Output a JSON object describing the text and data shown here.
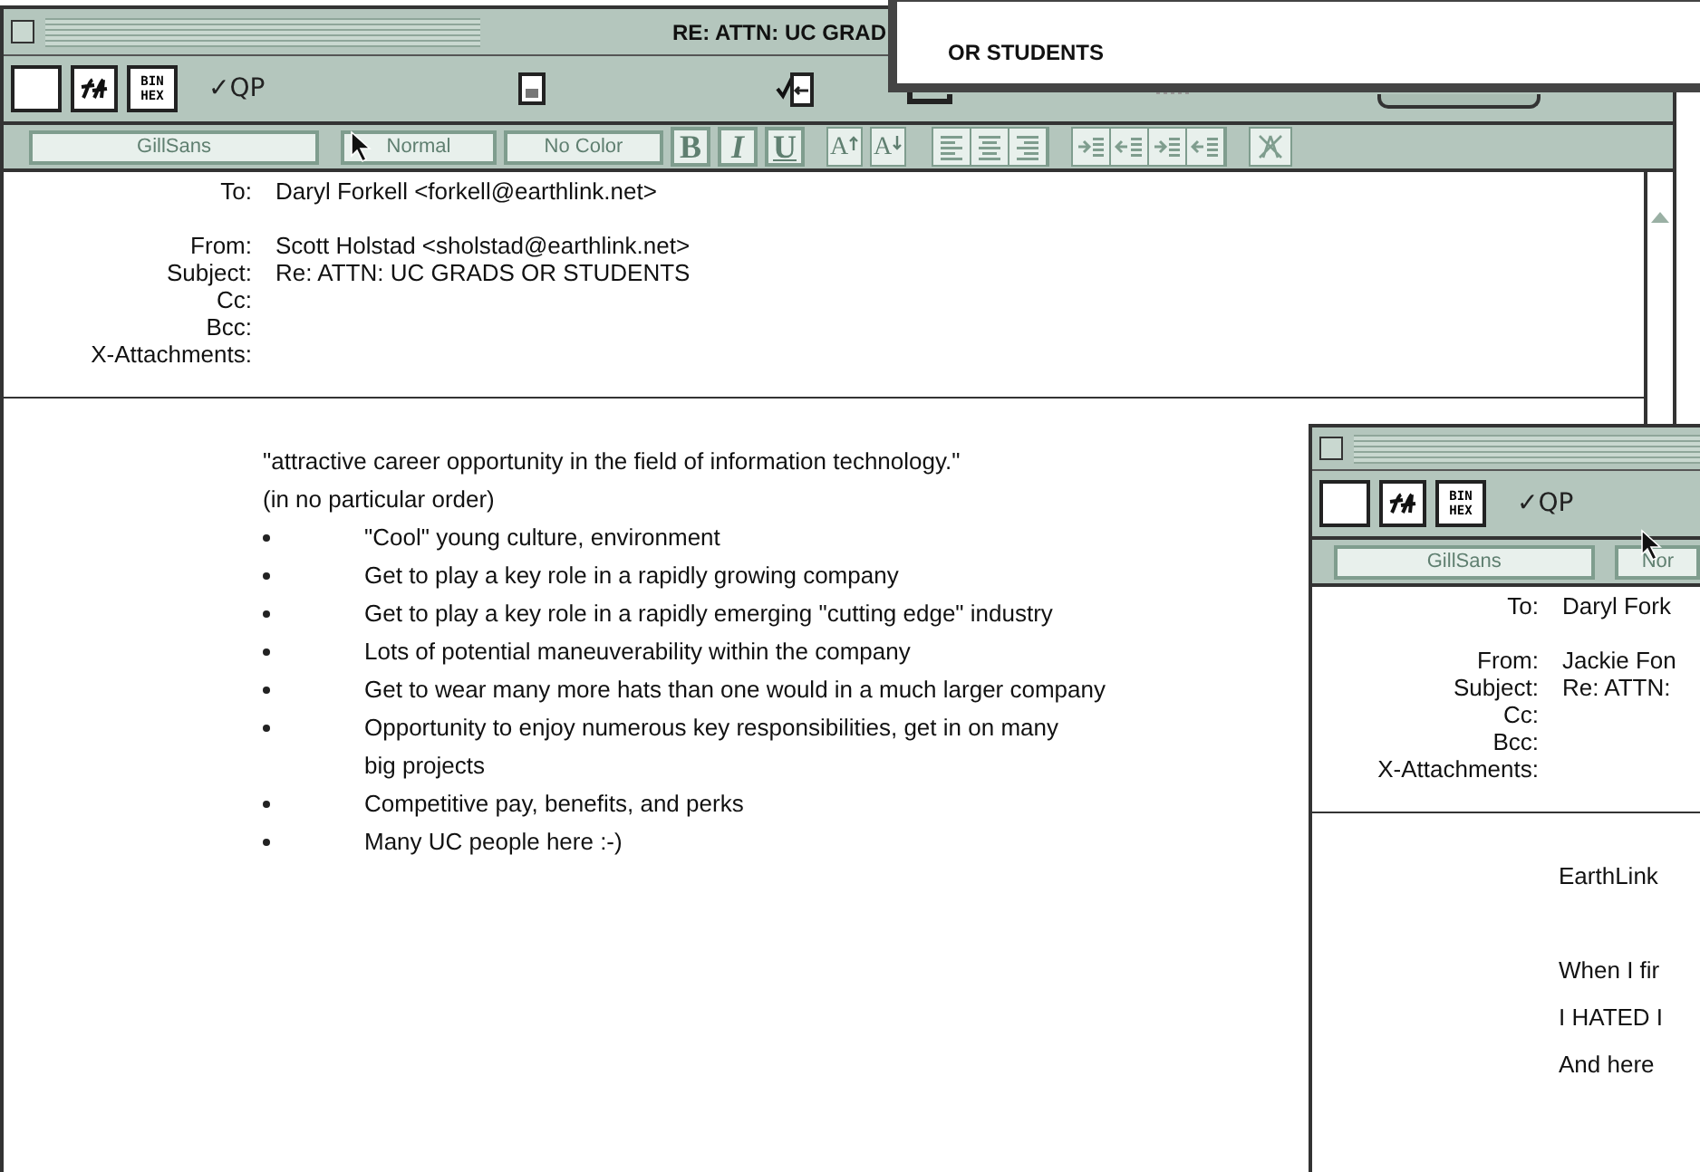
{
  "main_window": {
    "title": "RE: ATTN: UC GRAD",
    "toolbar": {
      "binhex": [
        "BIN",
        "HEX"
      ],
      "qp": "✓QP"
    },
    "format_bar": {
      "font": "GillSans",
      "size": "Normal",
      "color_label": "No Color",
      "styles": [
        "B",
        "I",
        "U"
      ],
      "size_buttons": [
        {
          "label": "A",
          "kind": "up"
        },
        {
          "label": "A",
          "kind": "down"
        }
      ]
    },
    "headers": [
      {
        "label": "To:",
        "value": "Daryl Forkell <forkell@earthlink.net>"
      },
      {
        "label": "From:",
        "value": "Scott Holstad <sholstad@earthlink.net>"
      },
      {
        "label": "Subject:",
        "value": "Re: ATTN: UC GRADS OR STUDENTS"
      },
      {
        "label": "Cc:"
      },
      {
        "label": "Bcc:"
      },
      {
        "label": "X-Attachments:"
      }
    ],
    "body": [
      {
        "kind": "text",
        "lines": [
          "\"attractive career opportunity in the field of information technology.\""
        ]
      },
      {
        "kind": "text",
        "lines": [
          "(in no particular order)"
        ]
      },
      {
        "kind": "bullet",
        "lines": [
          "\"Cool\" young culture, environment"
        ]
      },
      {
        "kind": "bullet",
        "lines": [
          "Get to play a key role in a rapidly growing company"
        ]
      },
      {
        "kind": "bullet",
        "lines": [
          "Get to play a key role in a rapidly emerging \"cutting edge\" industry"
        ]
      },
      {
        "kind": "bullet",
        "lines": [
          "Lots of potential maneuverability within the company"
        ]
      },
      {
        "kind": "bullet",
        "lines": [
          "Get to wear many more hats than one would in a much larger company"
        ]
      },
      {
        "kind": "bullet",
        "lines": [
          "Opportunity to enjoy numerous key responsibilities, get in on many",
          "big projects"
        ]
      },
      {
        "kind": "bullet",
        "lines": [
          "Competitive pay, benefits, and perks"
        ]
      },
      {
        "kind": "bullet",
        "lines": [
          "Many UC people here  :-)"
        ]
      }
    ]
  },
  "overlay_window": {
    "text": "OR STUDENTS"
  },
  "second_window": {
    "toolbar": {
      "binhex": [
        "BIN",
        "HEX"
      ],
      "qp": "✓QP"
    },
    "format_bar": {
      "font": "GillSans",
      "size": "Nor"
    },
    "headers": [
      {
        "label": "To:",
        "value": "Daryl Fork"
      },
      {
        "label": "From:",
        "value": "Jackie Fon"
      },
      {
        "label": "Subject:",
        "value": "Re: ATTN:"
      },
      {
        "label": "Cc:"
      },
      {
        "label": "Bcc:"
      },
      {
        "label": "X-Attachments:"
      }
    ],
    "body": [
      {
        "text": "EarthLink",
        "space_after": true
      },
      {
        "text": "When I fir"
      },
      {
        "text": "I HATED I"
      },
      {
        "text": "And here"
      }
    ]
  }
}
